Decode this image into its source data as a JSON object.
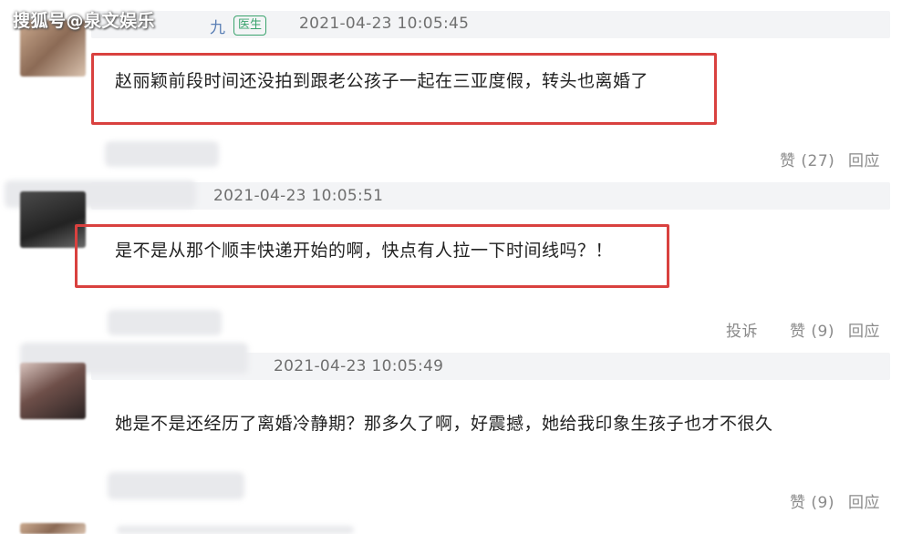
{
  "watermark": "搜狐号@泉文娱乐",
  "comments": [
    {
      "username": "九",
      "badge": "医生",
      "timestamp": "2021-04-23 10:05:45",
      "text": "赵丽颖前段时间还没拍到跟老公孩子一起在三亚度假，转头也离婚了",
      "like_label": "赞",
      "like_count": "(27)",
      "reply_label": "回应"
    },
    {
      "timestamp": "2021-04-23 10:05:51",
      "text": "是不是从那个顺丰快递开始的啊，快点有人拉一下时间线吗？！",
      "report_label": "投诉",
      "like_label": "赞",
      "like_count": "(9)",
      "reply_label": "回应"
    },
    {
      "timestamp": "2021-04-23 10:05:49",
      "text": "她是不是还经历了离婚冷静期？那多久了啊，好震撼，她给我印象生孩子也才不很久",
      "like_label": "赞",
      "like_count": "(9)",
      "reply_label": "回应"
    }
  ],
  "colors": {
    "highlight_border": "#d9413f",
    "badge": "#3aa36d",
    "timestamp": "#6f6f6f",
    "action": "#8a8a8a"
  }
}
